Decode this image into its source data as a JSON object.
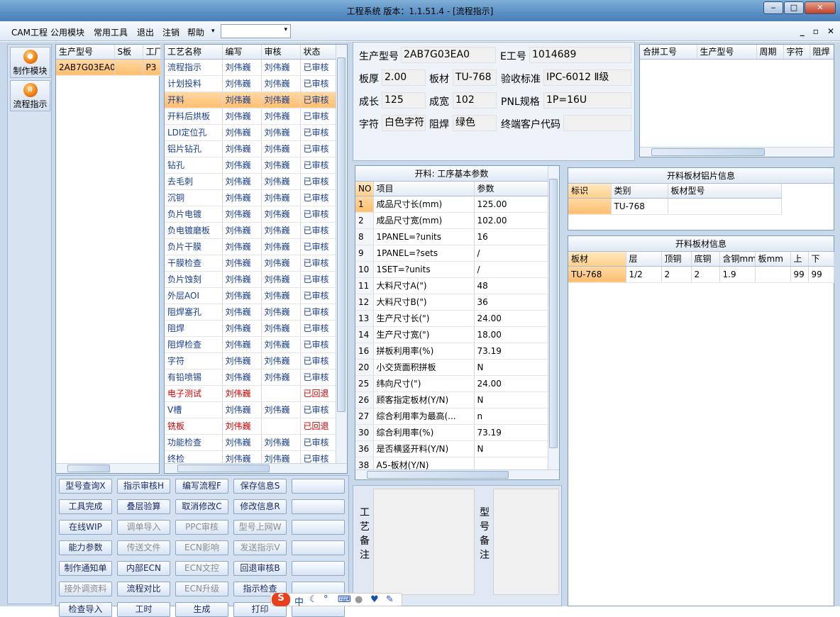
{
  "window": {
    "title": "工程系统  版本：1.1.51.4 - [流程指示]",
    "min": "‒",
    "max": "□",
    "close": "✕"
  },
  "menu": {
    "items": [
      "CAM工程",
      "公用模块",
      "常用工具",
      "退出",
      "注销",
      "帮助"
    ],
    "help_arrow": "▾",
    "combo_arrow": "▾",
    "mdi": [
      "_",
      "▫",
      "✕"
    ]
  },
  "nav": [
    {
      "label": "制作模块",
      "icon": "fire-icon"
    },
    {
      "label": "流程指示",
      "icon": "flow-icon"
    }
  ],
  "model_grid": {
    "headers": [
      "生产型号",
      "S板",
      "工厂"
    ],
    "rows": [
      {
        "model": "2AB7G03EA0",
        "s": "",
        "factory": "P3"
      }
    ]
  },
  "process_grid": {
    "headers": [
      "工艺名称",
      "编写",
      "审核",
      "状态"
    ],
    "rows": [
      {
        "name": "流程指示",
        "writer": "刘伟巍",
        "reviewer": "刘伟巍",
        "status": "已审核"
      },
      {
        "name": "计划投料",
        "writer": "刘伟巍",
        "reviewer": "刘伟巍",
        "status": "已审核"
      },
      {
        "name": "开料",
        "writer": "刘伟巍",
        "reviewer": "刘伟巍",
        "status": "已审核"
      },
      {
        "name": "开料后烘板",
        "writer": "刘伟巍",
        "reviewer": "刘伟巍",
        "status": "已审核"
      },
      {
        "name": "LDI定位孔",
        "writer": "刘伟巍",
        "reviewer": "刘伟巍",
        "status": "已审核"
      },
      {
        "name": "铝片钻孔",
        "writer": "刘伟巍",
        "reviewer": "刘伟巍",
        "status": "已审核"
      },
      {
        "name": "钻孔",
        "writer": "刘伟巍",
        "reviewer": "刘伟巍",
        "status": "已审核"
      },
      {
        "name": "去毛刺",
        "writer": "刘伟巍",
        "reviewer": "刘伟巍",
        "status": "已审核"
      },
      {
        "name": "沉铜",
        "writer": "刘伟巍",
        "reviewer": "刘伟巍",
        "status": "已审核"
      },
      {
        "name": "负片电镀",
        "writer": "刘伟巍",
        "reviewer": "刘伟巍",
        "status": "已审核"
      },
      {
        "name": "负电镀磨板",
        "writer": "刘伟巍",
        "reviewer": "刘伟巍",
        "status": "已审核"
      },
      {
        "name": "负片干膜",
        "writer": "刘伟巍",
        "reviewer": "刘伟巍",
        "status": "已审核"
      },
      {
        "name": "干膜检查",
        "writer": "刘伟巍",
        "reviewer": "刘伟巍",
        "status": "已审核"
      },
      {
        "name": "负片蚀刻",
        "writer": "刘伟巍",
        "reviewer": "刘伟巍",
        "status": "已审核"
      },
      {
        "name": "外层AOI",
        "writer": "刘伟巍",
        "reviewer": "刘伟巍",
        "status": "已审核"
      },
      {
        "name": "阻焊塞孔",
        "writer": "刘伟巍",
        "reviewer": "刘伟巍",
        "status": "已审核"
      },
      {
        "name": "阻焊",
        "writer": "刘伟巍",
        "reviewer": "刘伟巍",
        "status": "已审核"
      },
      {
        "name": "阻焊检查",
        "writer": "刘伟巍",
        "reviewer": "刘伟巍",
        "status": "已审核"
      },
      {
        "name": "字符",
        "writer": "刘伟巍",
        "reviewer": "刘伟巍",
        "status": "已审核"
      },
      {
        "name": "有铅喷锡",
        "writer": "刘伟巍",
        "reviewer": "刘伟巍",
        "status": "已审核"
      },
      {
        "name": "电子测试",
        "writer": "刘伟巍",
        "reviewer": "",
        "status": "已回退"
      },
      {
        "name": "V槽",
        "writer": "刘伟巍",
        "reviewer": "刘伟巍",
        "status": "已审核"
      },
      {
        "name": "铣板",
        "writer": "刘伟巍",
        "reviewer": "",
        "status": "已回退"
      },
      {
        "name": "功能检查",
        "writer": "刘伟巍",
        "reviewer": "刘伟巍",
        "status": "已审核"
      },
      {
        "name": "终检",
        "writer": "刘伟巍",
        "reviewer": "刘伟巍",
        "status": "已审核"
      }
    ]
  },
  "buttons": [
    [
      "型号查询X",
      "指示审核H",
      "编写流程F",
      "保存信息S",
      ""
    ],
    [
      "工具完成",
      "叠层验算",
      "取消修改C",
      "修改信息R",
      ""
    ],
    [
      "在线WIP",
      "调单导入",
      "PPC审核",
      "型号上网W",
      ""
    ],
    [
      "能力参数",
      "传送文件",
      "ECN影响",
      "发送指示V",
      ""
    ],
    [
      "制作通知单",
      "内部ECN",
      "ECN文控",
      "回退审核B",
      ""
    ],
    [
      "接外调资料",
      "流程对比",
      "ECN升级",
      "指示检查",
      ""
    ],
    [
      "检查导入",
      "工时",
      "生成",
      "打印",
      ""
    ]
  ],
  "info": {
    "model_label": "生产型号",
    "model": "2AB7G03EA0",
    "eno_label": "E工号",
    "eno": "1014689",
    "thick_label": "板厚",
    "thick": "2.00",
    "mat_label": "板材",
    "mat": "TU-768",
    "std_label": "验收标准",
    "std": "IPC-6012 Ⅱ级",
    "len_label": "成长",
    "len": "125",
    "wid_label": "成宽",
    "wid": "102",
    "pnl_label": "PNL规格",
    "pnl": "1P=16U",
    "char_label": "字符",
    "char": "白色字符",
    "mask_label": "阻焊",
    "mask": "绿色",
    "cust_label": "终端客户代码",
    "cust": ""
  },
  "merge_grid": {
    "headers": [
      "合拼工号",
      "生产型号",
      "周期",
      "字符",
      "阻焊"
    ]
  },
  "params": {
    "caption": "开料: 工序基本参数",
    "headers": [
      "NO",
      "项目",
      "参数"
    ],
    "rows": [
      {
        "no": "1",
        "item": "成品尺寸长(mm)",
        "value": "125.00"
      },
      {
        "no": "2",
        "item": "成品尺寸宽(mm)",
        "value": "102.00"
      },
      {
        "no": "8",
        "item": "1PANEL=?units",
        "value": "16"
      },
      {
        "no": "9",
        "item": "1PANEL=?sets",
        "value": "/"
      },
      {
        "no": "10",
        "item": "1SET=?units",
        "value": "/"
      },
      {
        "no": "11",
        "item": "大料尺寸A(\")",
        "value": "48"
      },
      {
        "no": "12",
        "item": "大料尺寸B(\")",
        "value": "36"
      },
      {
        "no": "13",
        "item": "生产尺寸长(\")",
        "value": "24.00"
      },
      {
        "no": "14",
        "item": "生产尺寸宽(\")",
        "value": "18.00"
      },
      {
        "no": "16",
        "item": "拼板利用率(%)",
        "value": "73.19"
      },
      {
        "no": "20",
        "item": "小交货面积拼板",
        "value": "N"
      },
      {
        "no": "25",
        "item": "纬向尺寸(\")",
        "value": "24.00"
      },
      {
        "no": "26",
        "item": "顾客指定板材(Y/N)",
        "value": "N"
      },
      {
        "no": "27",
        "item": "综合利用率为最高(...",
        "value": "n"
      },
      {
        "no": "30",
        "item": "综合利用率(%)",
        "value": "73.19"
      },
      {
        "no": "36",
        "item": "是否横竖开料(Y/N)",
        "value": "N"
      },
      {
        "no": "38",
        "item": "A5-板材(Y/N)",
        "value": ""
      }
    ]
  },
  "foil": {
    "caption": "开料板材铝片信息",
    "headers": [
      "标识",
      "类别",
      "板材型号"
    ],
    "rows": [
      {
        "flag": "",
        "type": "TU-768",
        "model": ""
      }
    ]
  },
  "sheet": {
    "caption": "开料板材信息",
    "headers": [
      "板材",
      "层",
      "顶铜",
      "底铜",
      "含铜mm",
      "板mm",
      "上",
      "下"
    ],
    "rows": [
      {
        "mat": "TU-768",
        "layer": "1/2",
        "top": "2",
        "bottom": "2",
        "cu": "1.9",
        "board": "",
        "up": "99",
        "down": "99"
      }
    ]
  },
  "remarks": {
    "process": [
      "工",
      "艺",
      "备",
      "注"
    ],
    "model": [
      "型",
      "号",
      "备",
      "注"
    ]
  },
  "ime": {
    "logo": "S",
    "text": "中"
  }
}
